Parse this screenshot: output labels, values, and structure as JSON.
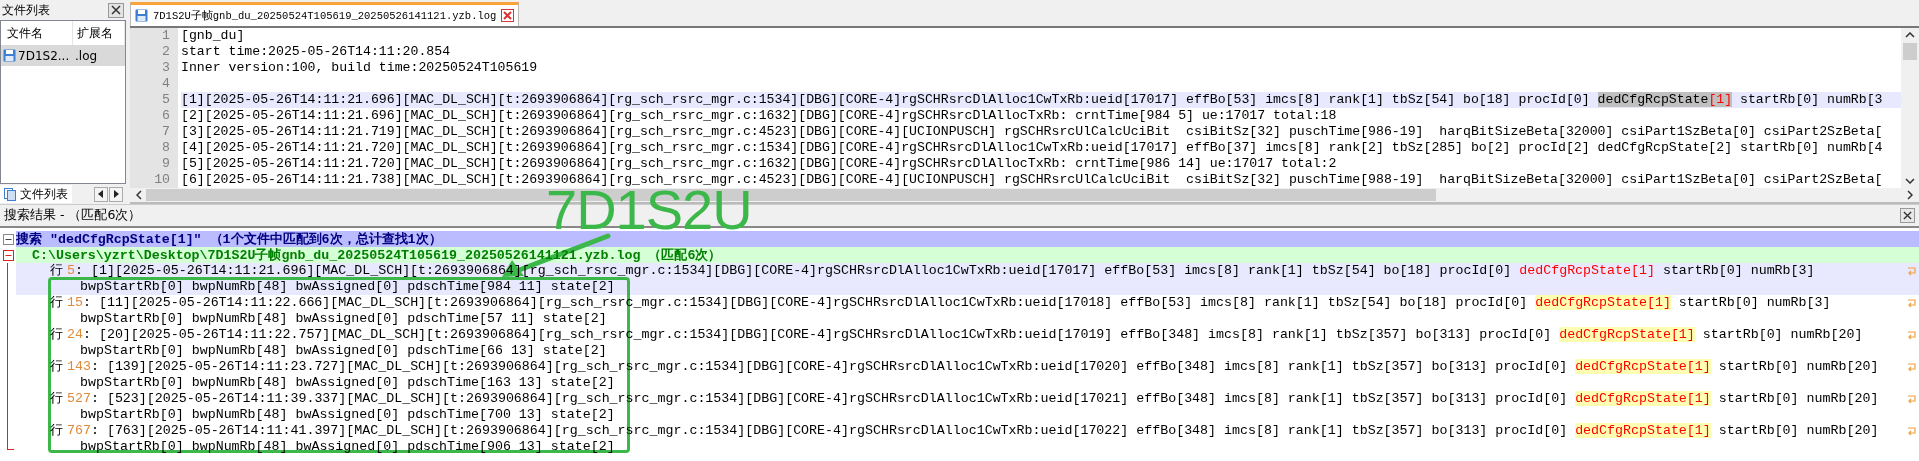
{
  "file_panel": {
    "title": "文件列表",
    "columns": [
      "文件名",
      "扩展名"
    ],
    "files": [
      {
        "name": "7D1S2...",
        "ext": ".log",
        "selected": true
      }
    ],
    "bottom_tab": "文件列表"
  },
  "editor": {
    "tabs": [
      {
        "title": "7D1S2U子帧gnb_du_20250524T105619_20250526141121.yzb.log",
        "selected": true
      }
    ],
    "lines": [
      {
        "no": "1",
        "current": false,
        "segments": [
          {
            "kind": "plain",
            "text": "[gnb_du]"
          }
        ]
      },
      {
        "no": "2",
        "current": false,
        "segments": [
          {
            "kind": "plain",
            "text": "start time:2025-05-26T14:11:20.854"
          }
        ]
      },
      {
        "no": "3",
        "current": false,
        "segments": [
          {
            "kind": "plain",
            "text": "Inner version:100, build time:20250524T105619"
          }
        ]
      },
      {
        "no": "4",
        "current": false
      },
      {
        "no": "5",
        "current": true,
        "segments": [
          {
            "kind": "plain",
            "text": "[1][2025-05-26T14:11:21.696][MAC_DL_SCH][t:2693906864][rg_sch_rsrc_mgr.c:1534][DBG][CORE-4]rgSCHRsrcDlAlloc1CwTxRb:ueid[17017] effBo[53] imcs[8] rank[1] tbSz[54] bo[18] procId[0] "
          },
          {
            "kind": "highlight",
            "text": "dedCfgRcpState"
          },
          {
            "kind": "brace",
            "text": "[1]"
          },
          {
            "kind": "plain",
            "text": " startRb[0] numRb[3"
          }
        ]
      },
      {
        "no": "6",
        "current": false,
        "segments": [
          {
            "kind": "plain",
            "text": "[2][2025-05-26T14:11:21.696][MAC_DL_SCH][t:2693906864][rg_sch_rsrc_mgr.c:1632][DBG][CORE-4]rgSCHRsrcDlAllocTxRb: crntTime[984 5] ue:17017 total:18"
          }
        ]
      },
      {
        "no": "7",
        "current": false,
        "segments": [
          {
            "kind": "plain",
            "text": "[3][2025-05-26T14:11:21.719][MAC_DL_SCH][t:2693906864][rg_sch_rsrc_mgr.c:4523][DBG][CORE-4][UCIONPUSCH] rgSCHRsrcUlCalcUciBit  csiBitSz[32] puschTime[986-19]  harqBitSizeBeta[32000] csiPart1SzBeta[0] csiPart2SzBeta["
          }
        ]
      },
      {
        "no": "8",
        "current": false,
        "segments": [
          {
            "kind": "plain",
            "text": "[4][2025-05-26T14:11:21.720][MAC_DL_SCH][t:2693906864][rg_sch_rsrc_mgr.c:1534][DBG][CORE-4]rgSCHRsrcDlAlloc1CwTxRb:ueid[17017] effBo[37] imcs[8] rank[2] tbSz[285] bo[2] procId[2] dedCfgRcpState[2] startRb[0] numRb[4"
          }
        ]
      },
      {
        "no": "9",
        "current": false,
        "segments": [
          {
            "kind": "plain",
            "text": "[5][2025-05-26T14:11:21.720][MAC_DL_SCH][t:2693906864][rg_sch_rsrc_mgr.c:1632][DBG][CORE-4]rgSCHRsrcDlAllocTxRb: crntTime[986 14] ue:17017 total:2"
          }
        ]
      },
      {
        "no": "10",
        "current": false,
        "segments": [
          {
            "kind": "plain",
            "text": "[6][2025-05-26T14:11:21.738][MAC_DL_SCH][t:2693906864][rg_sch_rsrc_mgr.c:4523][DBG][CORE-4][UCIONPUSCH] rgSCHRsrcUlCalcUciBit  csiBitSz[32] puschTime[988-19]  harqBitSizeBeta[32000] csiPart1SzBeta[0] csiPart2SzBeta["
          }
        ]
      }
    ]
  },
  "search_panel": {
    "title": "搜索结果 - （匹配6次）",
    "query": {
      "text": "搜索 \"dedCfgRcpState[1]\" （1个文件中匹配到6次，总计查找1次）",
      "expanded": true
    },
    "file": {
      "text": "C:\\Users\\yzrt\\Desktop\\7D1S2U子帧gnb_du_20250524T105619_20250526141121.yzb.log （匹配6次）",
      "expanded": true
    },
    "results": [
      {
        "prefix": "行",
        "line_no": "5",
        "selected": true,
        "before": ": [1][2025-05-26T14:11:21.696][MAC_DL_SCH][t:2693906864][rg_sch_rsrc_mgr.c:1534][DBG][CORE-4]rgSCHRsrcDlAlloc1CwTxRb:ueid[17017] effBo[53] imcs[8] rank[1] tbSz[54] bo[18] procId[0] ",
        "match": "dedCfgRcpState[1]",
        "after": " startRb[0] numRb[3]",
        "continuation": "bwpStartRb[0] bwpNumRb[48] bwAssigned[0] pdschTime[984 11] state[2]"
      },
      {
        "prefix": "行",
        "line_no": "15",
        "selected": false,
        "before": ": [11][2025-05-26T14:11:22.666][MAC_DL_SCH][t:2693906864][rg_sch_rsrc_mgr.c:1534][DBG][CORE-4]rgSCHRsrcDlAlloc1CwTxRb:ueid[17018] effBo[53] imcs[8] rank[1] tbSz[54] bo[18] procId[0] ",
        "match": "dedCfgRcpState[1]",
        "after": " startRb[0] numRb[3]",
        "continuation": "bwpStartRb[0] bwpNumRb[48] bwAssigned[0] pdschTime[57 11] state[2]"
      },
      {
        "prefix": "行",
        "line_no": "24",
        "selected": false,
        "before": ": [20][2025-05-26T14:11:22.757][MAC_DL_SCH][t:2693906864][rg_sch_rsrc_mgr.c:1534][DBG][CORE-4]rgSCHRsrcDlAlloc1CwTxRb:ueid[17019] effBo[348] imcs[8] rank[1] tbSz[357] bo[313] procId[0] ",
        "match": "dedCfgRcpState[1]",
        "after": " startRb[0] numRb[20]",
        "continuation": "bwpStartRb[0] bwpNumRb[48] bwAssigned[0] pdschTime[66 13] state[2]"
      },
      {
        "prefix": "行",
        "line_no": "143",
        "selected": false,
        "before": ": [139][2025-05-26T14:11:23.727][MAC_DL_SCH][t:2693906864][rg_sch_rsrc_mgr.c:1534][DBG][CORE-4]rgSCHRsrcDlAlloc1CwTxRb:ueid[17020] effBo[348] imcs[8] rank[1] tbSz[357] bo[313] procId[0] ",
        "match": "dedCfgRcpState[1]",
        "after": " startRb[0] numRb[20]",
        "continuation": "bwpStartRb[0] bwpNumRb[48] bwAssigned[0] pdschTime[163 13] state[2]"
      },
      {
        "prefix": "行",
        "line_no": "527",
        "selected": false,
        "before": ": [523][2025-05-26T14:11:39.337][MAC_DL_SCH][t:2693906864][rg_sch_rsrc_mgr.c:1534][DBG][CORE-4]rgSCHRsrcDlAlloc1CwTxRb:ueid[17021] effBo[348] imcs[8] rank[1] tbSz[357] bo[313] procId[0] ",
        "match": "dedCfgRcpState[1]",
        "after": " startRb[0] numRb[20]",
        "continuation": "bwpStartRb[0] bwpNumRb[48] bwAssigned[0] pdschTime[700 13] state[2]"
      },
      {
        "prefix": "行",
        "line_no": "767",
        "selected": false,
        "before": ": [763][2025-05-26T14:11:41.397][MAC_DL_SCH][t:2693906864][rg_sch_rsrc_mgr.c:1534][DBG][CORE-4]rgSCHRsrcDlAlloc1CwTxRb:ueid[17022] effBo[348] imcs[8] rank[1] tbSz[357] bo[313] procId[0] ",
        "match": "dedCfgRcpState[1]",
        "after": " startRb[0] numRb[20]",
        "continuation": "bwpStartRb[0] bwpNumRb[48] bwAssigned[0] pdschTime[906 13] state[2]"
      }
    ]
  },
  "annotation": {
    "label": "7D1S2U"
  }
}
